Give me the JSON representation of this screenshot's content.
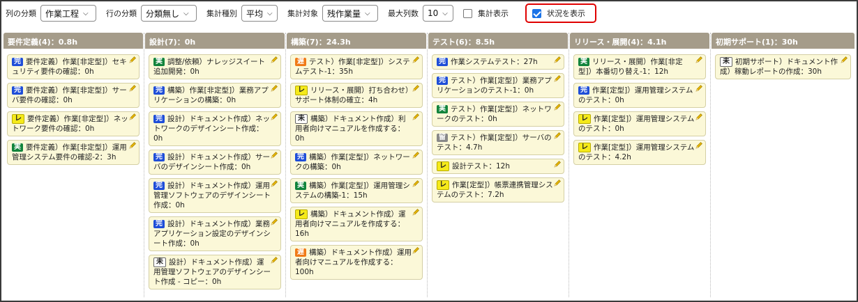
{
  "toolbar": {
    "col_group_label": "列の分類",
    "col_group_value": "作業工程",
    "row_group_label": "行の分類",
    "row_group_value": "分類無し",
    "agg_type_label": "集計種別",
    "agg_type_value": "平均",
    "agg_target_label": "集計対象",
    "agg_target_value": "残作業量",
    "max_cols_label": "最大列数",
    "max_cols_value": "10",
    "show_total_label": "集計表示",
    "show_total_checked": false,
    "show_status_label": "状況を表示",
    "show_status_checked": true
  },
  "colors": {
    "header_bg": "#a59c8a",
    "card_bg": "#fbf8d8",
    "badge_done": "#1f4ed8",
    "badge_active": "#12843c",
    "badge_review": "#f5ea1a",
    "badge_late": "#f07a18",
    "badge_hold": "#888888",
    "highlight": "#e00000"
  },
  "columns": [
    {
      "header": "要件定義(4)：0.8h",
      "cards": [
        {
          "badge": "完",
          "kind": "kan",
          "text": "要件定義）作業[非定型]）セキュリティ要件の確認：0h"
        },
        {
          "badge": "完",
          "kind": "kan",
          "text": "要件定義）作業[非定型]）サーバ要件の確認：0h"
        },
        {
          "badge": "レ",
          "kind": "re",
          "text": "要件定義）作業[非定型]）ネットワーク要件の確認：0h"
        },
        {
          "badge": "実",
          "kind": "jitsu",
          "text": "要件定義）作業[非定型]）運用管理システム要件の確認-2：3h"
        }
      ]
    },
    {
      "header": "設計(7)：0h",
      "cards": [
        {
          "badge": "実",
          "kind": "jitsu",
          "text": "調整/依頼）ナレッジスイート追加開発：0h"
        },
        {
          "badge": "完",
          "kind": "kan",
          "text": "構築）作業[非定型]）業務アプリケーションの構築：0h"
        },
        {
          "badge": "完",
          "kind": "kan",
          "text": "設計）ドキュメント作成）ネットワークのデザインシート作成：0h"
        },
        {
          "badge": "完",
          "kind": "kan",
          "text": "設計）ドキュメント作成）サーバのデザインシート作成：0h"
        },
        {
          "badge": "完",
          "kind": "kan",
          "text": "設計）ドキュメント作成）運用管理ソフトウェアのデザインシート作成：0h"
        },
        {
          "badge": "完",
          "kind": "kan",
          "text": "設計）ドキュメント作成）業務アプリケーション設定のデザインシート作成：0h"
        },
        {
          "badge": "未",
          "kind": "mi",
          "text": "設計）ドキュメント作成）運用管理ソフトウェアのデザインシート作成 - コピー：0h"
        }
      ]
    },
    {
      "header": "構築(7)：24.3h",
      "cards": [
        {
          "badge": "遅",
          "kind": "chi",
          "text": "テスト）作業[非定型]）システムテスト-1：35h"
        },
        {
          "badge": "レ",
          "kind": "re",
          "text": "リリース・展開）打ち合わせ）サポート体制の確立：4h"
        },
        {
          "badge": "未",
          "kind": "mi",
          "text": "構築）ドキュメント作成）利用者向けマニュアルを作成する：0h"
        },
        {
          "badge": "完",
          "kind": "kan",
          "text": "構築）作業[定型]）ネットワークの構築：0h"
        },
        {
          "badge": "実",
          "kind": "jitsu",
          "text": "構築）作業[定型]）運用管理システムの構築-1：15h"
        },
        {
          "badge": "レ",
          "kind": "re",
          "text": "構築）ドキュメント作成）運用者向けマニュアルを作成する：16h"
        },
        {
          "badge": "遅",
          "kind": "chi",
          "text": "構築）ドキュメント作成）運用者向けマニュアルを作成する：100h"
        }
      ]
    },
    {
      "header": "テスト(6)：8.5h",
      "cards": [
        {
          "badge": "完",
          "kind": "kan",
          "text": "作業システムテスト：27h"
        },
        {
          "badge": "完",
          "kind": "kan",
          "text": "テスト）作業[定型]）業務アプリケーションのテスト-1：0h"
        },
        {
          "badge": "実",
          "kind": "jitsu",
          "text": "テスト）作業[定型]）ネットワークのテスト：0h"
        },
        {
          "badge": "留",
          "kind": "ryu",
          "text": "テスト）作業[定型]）サーバのテスト：4.7h"
        },
        {
          "badge": "レ",
          "kind": "re",
          "text": "設計テスト：12h"
        },
        {
          "badge": "レ",
          "kind": "re",
          "text": "作業[定型]）帳票連携管理システムのテスト：7.2h"
        }
      ]
    },
    {
      "header": "リリース・展開(4)：4.1h",
      "cards": [
        {
          "badge": "実",
          "kind": "jitsu",
          "text": "リリース・展開）作業[非定型]）本番切り替え-1：12h"
        },
        {
          "badge": "完",
          "kind": "kan",
          "text": "作業[定型]）運用管理システムのテスト：0h"
        },
        {
          "badge": "レ",
          "kind": "re",
          "text": "作業[定型]）運用管理システムのテスト：0h"
        },
        {
          "badge": "レ",
          "kind": "re",
          "text": "作業[定型]）運用管理システムのテスト：4.2h"
        }
      ]
    },
    {
      "header": "初期サポート(1)：30h",
      "cards": [
        {
          "badge": "未",
          "kind": "mi",
          "text": "初期サポート）ドキュメント作成）稼動レポートの作成：30h"
        }
      ]
    }
  ]
}
